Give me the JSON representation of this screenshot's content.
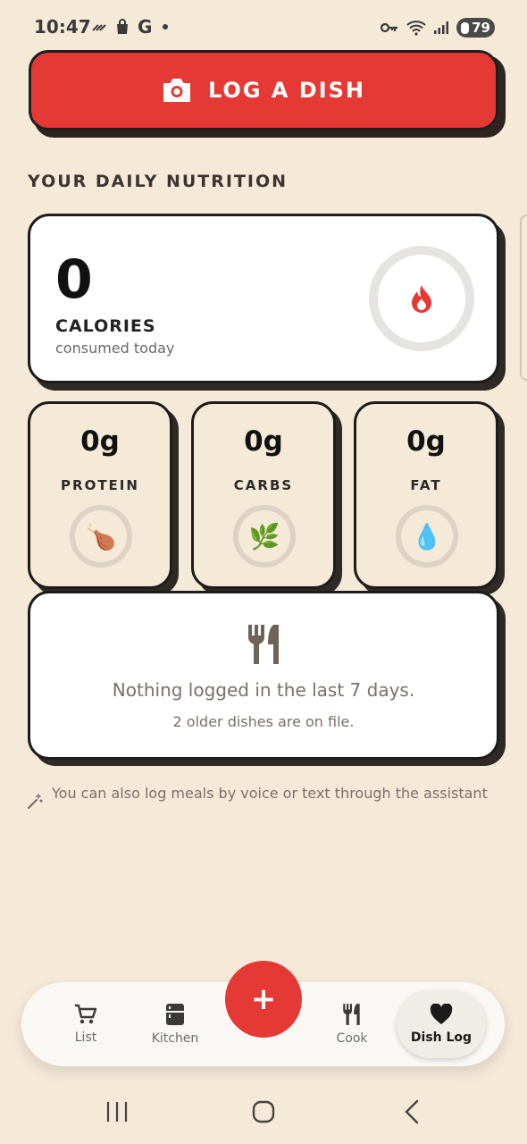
{
  "status_bar": {
    "time": "10:47",
    "g_icon": "G",
    "battery": "79"
  },
  "log_button": {
    "label": "LOG A DISH",
    "icon": "camera-icon"
  },
  "section": {
    "title": "YOUR DAILY NUTRITION"
  },
  "calories": {
    "value": "0",
    "label": "CALORIES",
    "sub": "consumed today",
    "icon": "flame-icon"
  },
  "macros": [
    {
      "value": "0g",
      "label": "PROTEIN",
      "emoji": "🍗"
    },
    {
      "value": "0g",
      "label": "CARBS",
      "emoji": "🌿"
    },
    {
      "value": "0g",
      "label": "FAT",
      "emoji": "💧"
    }
  ],
  "empty_state": {
    "title": "Nothing logged in the last 7 days.",
    "subtitle": "2 older dishes are on file.",
    "icon": "utensils-icon"
  },
  "hint": {
    "text": "You can also log meals by voice or text through the assistant",
    "icon": "magic-wand-icon"
  },
  "nav": {
    "items": [
      {
        "label": "List",
        "icon": "cart-icon"
      },
      {
        "label": "Kitchen",
        "icon": "fridge-icon"
      },
      {
        "label": "Cook",
        "icon": "utensils-icon"
      },
      {
        "label": "Dish Log",
        "icon": "heart-icon"
      }
    ],
    "fab": "+",
    "active": "Dish Log"
  },
  "colors": {
    "accent": "#e53935",
    "background": "#f5e9d8",
    "card": "#ffffff"
  }
}
